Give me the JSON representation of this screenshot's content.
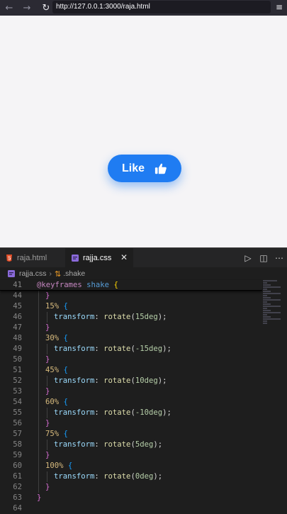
{
  "browser": {
    "url": "http://127.0.0.1:3000/raja.html"
  },
  "page": {
    "like_label": "Like"
  },
  "editor": {
    "tabs": [
      {
        "label": "raja.html"
      },
      {
        "label": "rajja.css"
      }
    ],
    "breadcrumb": {
      "file": "rajja.css",
      "symbol": ".shake"
    },
    "lines": [
      {
        "n": "41",
        "code": "@keyframes shake {"
      },
      {
        "n": "44",
        "code": "}"
      },
      {
        "n": "45",
        "code": "15% {"
      },
      {
        "n": "46",
        "code": "transform: rotate(15deg);"
      },
      {
        "n": "47",
        "code": "}"
      },
      {
        "n": "48",
        "code": "30% {"
      },
      {
        "n": "49",
        "code": "transform: rotate(-15deg);"
      },
      {
        "n": "50",
        "code": "}"
      },
      {
        "n": "51",
        "code": "45% {"
      },
      {
        "n": "52",
        "code": "transform: rotate(10deg);"
      },
      {
        "n": "53",
        "code": "}"
      },
      {
        "n": "54",
        "code": "60% {"
      },
      {
        "n": "55",
        "code": "transform: rotate(-10deg);"
      },
      {
        "n": "56",
        "code": "}"
      },
      {
        "n": "57",
        "code": "75% {"
      },
      {
        "n": "58",
        "code": "transform: rotate(5deg);"
      },
      {
        "n": "59",
        "code": "}"
      },
      {
        "n": "60",
        "code": "100% {"
      },
      {
        "n": "61",
        "code": "transform: rotate(0deg);"
      },
      {
        "n": "62",
        "code": "}"
      },
      {
        "n": "63",
        "code": "}"
      },
      {
        "n": "64",
        "code": ""
      }
    ]
  },
  "colors": {
    "accent": "#1f7cf2",
    "page_bg": "#f5f4f6",
    "editor_bg": "#1e1e1e"
  }
}
